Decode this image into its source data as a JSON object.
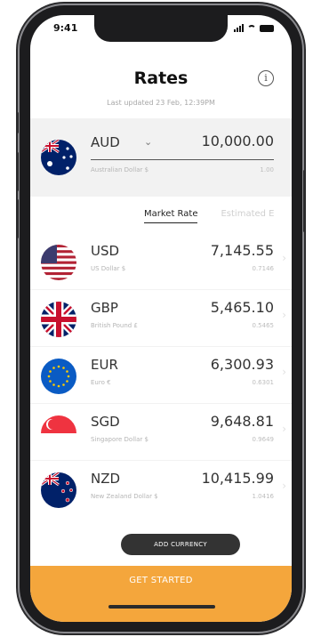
{
  "status_bar": {
    "time": "9:41"
  },
  "header": {
    "title": "Rates",
    "last_updated": "Last updated 23 Feb, 12:39PM"
  },
  "base_currency": {
    "code": "AUD",
    "name": "Australian Dollar $",
    "amount": "10,000.00",
    "rate": "1.00",
    "flag_icon": "australia-flag-icon"
  },
  "tabs": [
    {
      "label": "Market Rate",
      "active": true
    },
    {
      "label": "Estimated E",
      "active": false
    }
  ],
  "currencies": [
    {
      "code": "USD",
      "name": "US Dollar $",
      "amount": "7,145.55",
      "rate": "0.7146",
      "flag_icon": "usa-flag-icon"
    },
    {
      "code": "GBP",
      "name": "British Pound £",
      "amount": "5,465.10",
      "rate": "0.5465",
      "flag_icon": "uk-flag-icon"
    },
    {
      "code": "EUR",
      "name": "Euro €",
      "amount": "6,300.93",
      "rate": "0.6301",
      "flag_icon": "eu-flag-icon"
    },
    {
      "code": "SGD",
      "name": "Singapore Dollar $",
      "amount": "9,648.81",
      "rate": "0.9649",
      "flag_icon": "singapore-flag-icon"
    },
    {
      "code": "NZD",
      "name": "New Zealand Dollar $",
      "amount": "10,415.99",
      "rate": "1.0416",
      "flag_icon": "new-zealand-flag-icon"
    }
  ],
  "add_currency_label": "ADD CURRENCY",
  "cta_label": "GET STARTED",
  "colors": {
    "accent": "#f4a63c",
    "button_dark": "#333333",
    "base_card_bg": "#f2f2f2"
  }
}
